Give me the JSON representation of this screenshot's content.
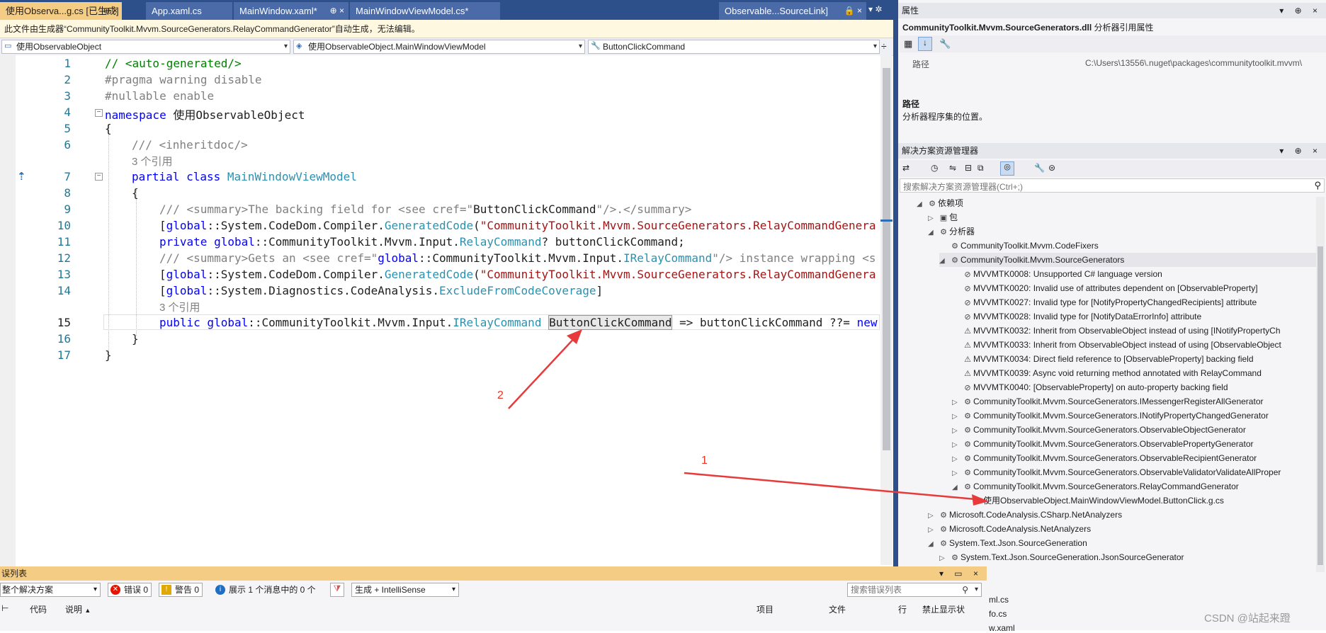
{
  "tabs": [
    {
      "label": "使用Observa...g.cs [已生成]",
      "pin": "⊕",
      "close": "×",
      "active": true
    },
    {
      "label": "App.xaml.cs",
      "active": false
    },
    {
      "label": "MainWindow.xaml*",
      "pin": "⊕",
      "close": "×",
      "active": false
    },
    {
      "label": "MainWindowViewModel.cs*",
      "active": false
    },
    {
      "label": "Observable...SourceLink]",
      "active": false
    }
  ],
  "infobar": {
    "text": "此文件由生成器“CommunityToolkit.Mvvm.SourceGenerators.RelayCommandGenerator”自动生成，无法编辑。"
  },
  "nav": {
    "project": "使用ObservableObject",
    "type": "使用ObservableObject.MainWindowViewModel",
    "member": "ButtonClickCommand"
  },
  "editor": {
    "line_numbers": [
      "1",
      "2",
      "3",
      "4",
      "5",
      "6",
      "",
      "7",
      "8",
      "9",
      "10",
      "11",
      "12",
      "13",
      "14",
      "",
      "15",
      "16",
      "17"
    ],
    "lines": {
      "l1": "// <auto-generated/>",
      "l2": "#pragma warning disable",
      "l3": "#nullable enable",
      "l4a": "namespace",
      "l4b": " 使用ObservableObject",
      "l5": "{",
      "l6": "/// <inheritdoc/>",
      "ref1": "3 个引用",
      "l7a": "partial class",
      "l7b": " MainWindowViewModel",
      "l8": "{",
      "l9a": "/// <summary>The backing field for <see cref=\"",
      "l9b": "ButtonClickCommand",
      "l9c": "\"/>.</summary>",
      "l10a": "[",
      "l10b": "global",
      "l10c": "::System.CodeDom.Compiler.",
      "l10d": "GeneratedCode",
      "l10e": "(",
      "l10f": "\"CommunityToolkit.Mvvm.SourceGenerators.RelayCommandGenera",
      "l11a": "private",
      "l11b": " global",
      "l11c": "::CommunityToolkit.Mvvm.Input.",
      "l11d": "RelayCommand",
      "l11e": "? buttonClickCommand;",
      "l12a": "/// <summary>Gets an <see cref=\"",
      "l12b": "global",
      "l12c": "::CommunityToolkit.Mvvm.Input.",
      "l12d": "IRelayCommand",
      "l12e": "\"/> instance wrapping <s",
      "l13a": "[",
      "l13b": "global",
      "l13c": "::System.CodeDom.Compiler.",
      "l13d": "GeneratedCode",
      "l13e": "(",
      "l13f": "\"CommunityToolkit.Mvvm.SourceGenerators.RelayCommandGenera",
      "l14a": "[",
      "l14b": "global",
      "l14c": "::System.Diagnostics.CodeAnalysis.",
      "l14d": "ExcludeFromCodeCoverage",
      "l14e": "]",
      "ref2": "3 个引用",
      "l15a": "public",
      "l15b": " global",
      "l15c": "::CommunityToolkit.Mvvm.Input.",
      "l15d": "IRelayCommand",
      "l15e": "ButtonClickCommand",
      "l15f": " => buttonClickCommand ??= ",
      "l15g": "new",
      "l16": "}",
      "l17": "}"
    }
  },
  "properties": {
    "title": "属性",
    "object": "CommunityToolkit.Mvvm.SourceGenerators.dll",
    "object_type": "分析器引用属性",
    "row_label": "路径",
    "row_value": "C:\\Users\\13556\\.nuget\\packages\\communitytoolkit.mvvm\\",
    "desc_title": "路径",
    "desc_text": "分析器程序集的位置。"
  },
  "solution_explorer": {
    "title": "解决方案资源管理器",
    "search_placeholder": "搜索解决方案资源管理器(Ctrl+;)",
    "items": [
      {
        "label": "依赖项",
        "exp": "◢",
        "ico": "⚙"
      },
      {
        "label": "包",
        "exp": "▷",
        "ico": "▣"
      },
      {
        "label": "分析器",
        "exp": "◢",
        "ico": "⚙"
      },
      {
        "label": "CommunityToolkit.Mvvm.CodeFixers",
        "exp": "",
        "ico": "⚙"
      },
      {
        "label": "CommunityToolkit.Mvvm.SourceGenerators",
        "exp": "◢",
        "ico": "⚙"
      },
      {
        "label": "MVVMTK0008: Unsupported C# language version",
        "exp": "",
        "ico": "⊘"
      },
      {
        "label": "MVVMTK0020: Invalid use of attributes dependent on [ObservableProperty]",
        "exp": "",
        "ico": "⊘"
      },
      {
        "label": "MVVMTK0027: Invalid type for [NotifyPropertyChangedRecipients] attribute",
        "exp": "",
        "ico": "⊘"
      },
      {
        "label": "MVVMTK0028: Invalid type for [NotifyDataErrorInfo] attribute",
        "exp": "",
        "ico": "⊘"
      },
      {
        "label": "MVVMTK0032: Inherit from ObservableObject instead of using [INotifyPropertyCh",
        "exp": "",
        "ico": "⚠"
      },
      {
        "label": "MVVMTK0033: Inherit from ObservableObject instead of using [ObservableObject",
        "exp": "",
        "ico": "⚠"
      },
      {
        "label": "MVVMTK0034: Direct field reference to [ObservableProperty] backing field",
        "exp": "",
        "ico": "⚠"
      },
      {
        "label": "MVVMTK0039: Async void returning method annotated with RelayCommand",
        "exp": "",
        "ico": "⚠"
      },
      {
        "label": "MVVMTK0040: [ObservableProperty] on auto-property backing field",
        "exp": "",
        "ico": "⊘"
      },
      {
        "label": "CommunityToolkit.Mvvm.SourceGenerators.IMessengerRegisterAllGenerator",
        "exp": "▷",
        "ico": "⚙"
      },
      {
        "label": "CommunityToolkit.Mvvm.SourceGenerators.INotifyPropertyChangedGenerator",
        "exp": "▷",
        "ico": "⚙"
      },
      {
        "label": "CommunityToolkit.Mvvm.SourceGenerators.ObservableObjectGenerator",
        "exp": "▷",
        "ico": "⚙"
      },
      {
        "label": "CommunityToolkit.Mvvm.SourceGenerators.ObservablePropertyGenerator",
        "exp": "▷",
        "ico": "⚙"
      },
      {
        "label": "CommunityToolkit.Mvvm.SourceGenerators.ObservableRecipientGenerator",
        "exp": "▷",
        "ico": "⚙"
      },
      {
        "label": "CommunityToolkit.Mvvm.SourceGenerators.ObservableValidatorValidateAllProper",
        "exp": "▷",
        "ico": "⚙"
      },
      {
        "label": "CommunityToolkit.Mvvm.SourceGenerators.RelayCommandGenerator",
        "exp": "◢",
        "ico": "⚙"
      },
      {
        "label": "使用ObservableObject.MainWindowViewModel.ButtonClick.g.cs",
        "exp": "",
        "ico": "C#"
      },
      {
        "label": "Microsoft.CodeAnalysis.CSharp.NetAnalyzers",
        "exp": "▷",
        "ico": "⚙"
      },
      {
        "label": "Microsoft.CodeAnalysis.NetAnalyzers",
        "exp": "▷",
        "ico": "⚙"
      },
      {
        "label": "System.Text.Json.SourceGeneration",
        "exp": "◢",
        "ico": "⚙"
      },
      {
        "label": "System.Text.Json.SourceGeneration.JsonSourceGenerator",
        "exp": "▷",
        "ico": "⚙"
      }
    ],
    "bottom_items": [
      "ml.cs",
      "fo.cs",
      "w.xaml"
    ]
  },
  "error_list": {
    "title": "误列表",
    "scope": "整个解决方案",
    "errors": "错误 0",
    "warnings": "警告 0",
    "messages": "展示 1 个消息中的 0 个",
    "build_filter": "生成 + IntelliSense",
    "search_placeholder": "搜索错误列表",
    "columns": [
      "代码",
      "说明",
      "项目",
      "文件",
      "行",
      "禁止显示状"
    ]
  },
  "annotations": {
    "one": "1",
    "two": "2"
  },
  "watermark": "CSDN @站起来蹬",
  "colors": {
    "accent_tab": "#f5cc84",
    "tabbar": "#2d4f8a",
    "keyword": "#0000ff",
    "type": "#2b91af",
    "string": "#a31515",
    "arrow": "#e83a3a"
  }
}
